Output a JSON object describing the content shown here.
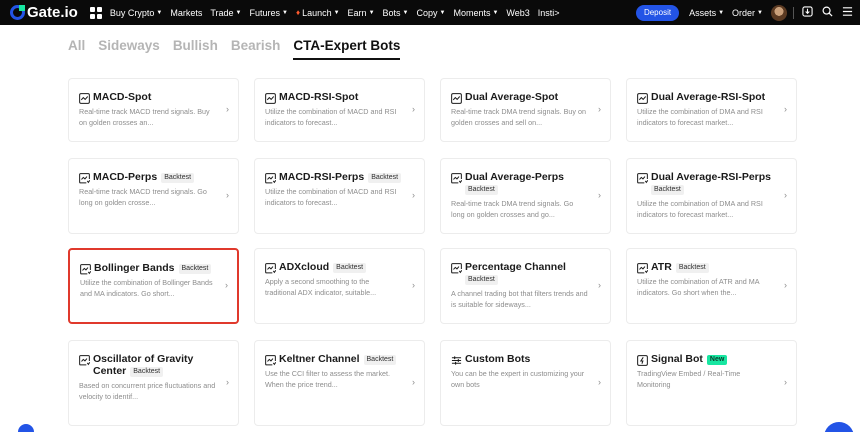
{
  "nav": {
    "logo": "Gate.io",
    "items": [
      {
        "label": "Buy Crypto",
        "caret": true
      },
      {
        "label": "Markets",
        "caret": false
      },
      {
        "label": "Trade",
        "caret": true
      },
      {
        "label": "Futures",
        "caret": true
      },
      {
        "label": "Launch",
        "caret": true,
        "fire": true
      },
      {
        "label": "Earn",
        "caret": true
      },
      {
        "label": "Bots",
        "caret": true
      },
      {
        "label": "Copy",
        "caret": true
      },
      {
        "label": "Moments",
        "caret": true
      },
      {
        "label": "Web3",
        "caret": false
      },
      {
        "label": "Insti>",
        "caret": false
      }
    ],
    "deposit_label": "Deposit",
    "assets_label": "Assets",
    "order_label": "Order",
    "brand_color": "#2354e6",
    "accent_green": "#17e6a1"
  },
  "tabs": [
    {
      "label": "All",
      "active": false
    },
    {
      "label": "Sideways",
      "active": false
    },
    {
      "label": "Bullish",
      "active": false
    },
    {
      "label": "Bearish",
      "active": false
    },
    {
      "label": "CTA-Expert Bots",
      "active": true
    }
  ],
  "cards": [
    {
      "title": "MACD-Spot",
      "badge": "",
      "icon": "trend-chart-icon",
      "desc": "Real-time track MACD trend signals. Buy on golden crosses an..."
    },
    {
      "title": "MACD-RSI-Spot",
      "badge": "",
      "icon": "trend-chart-icon",
      "desc": "Utilize the combination of MACD and RSI indicators to forecast..."
    },
    {
      "title": "Dual Average-Spot",
      "badge": "",
      "icon": "trend-chart-icon",
      "desc": "Real-time track DMA trend signals. Buy on golden crosses and sell on..."
    },
    {
      "title": "Dual Average-RSI-Spot",
      "badge": "",
      "icon": "trend-chart-icon",
      "desc": "Utilize the combination of DMA and RSI indicators to forecast market..."
    },
    {
      "title": "MACD-Perps",
      "badge": "Backtest",
      "icon": "futures-chart-icon",
      "desc": "Real-time track MACD trend signals. Go long on golden crosse..."
    },
    {
      "title": "MACD-RSI-Perps",
      "badge": "Backtest",
      "icon": "futures-chart-icon",
      "desc": "Utilize the combination of MACD and RSI indicators to forecast..."
    },
    {
      "title": "Dual Average-Perps",
      "badge": "Backtest",
      "icon": "futures-chart-icon",
      "desc": "Real-time track DMA trend signals. Go long on golden crosses and go..."
    },
    {
      "title": "Dual Average-RSI-Perps",
      "badge": "Backtest",
      "icon": "futures-chart-icon",
      "desc": "Utilize the combination of DMA and RSI indicators to forecast market..."
    },
    {
      "title": "Bollinger Bands",
      "badge": "Backtest",
      "icon": "futures-chart-icon",
      "desc": "Utilize the combination of Bollinger Bands and MA indicators. Go short...",
      "highlight": true
    },
    {
      "title": "ADXcloud",
      "badge": "Backtest",
      "icon": "futures-chart-icon",
      "desc": "Apply a second smoothing to the traditional ADX indicator, suitable..."
    },
    {
      "title": "Percentage Channel",
      "badge": "Backtest",
      "icon": "futures-chart-icon",
      "desc": "A channel trading bot that filters trends and is suitable for sideways..."
    },
    {
      "title": "ATR",
      "badge": "Backtest",
      "icon": "futures-chart-icon",
      "desc": "Utilize the combination of ATR and MA indicators. Go short when the..."
    },
    {
      "title": "Oscillator of Gravity Center",
      "badge": "Backtest",
      "icon": "futures-chart-icon",
      "desc": "Based on concurrent price fluctuations and velocity to identif..."
    },
    {
      "title": "Keltner Channel",
      "badge": "Backtest",
      "icon": "futures-chart-icon",
      "desc": "Use the CCI filter to assess the market. When the price trend..."
    },
    {
      "title": "Custom Bots",
      "badge": "",
      "icon": "sliders-icon",
      "desc": "You can be the expert in customizing your own bots"
    },
    {
      "title": "Signal Bot",
      "badge": "New",
      "icon": "signal-icon",
      "desc": "TradingView Embed / Real-Time Monitoring"
    }
  ]
}
